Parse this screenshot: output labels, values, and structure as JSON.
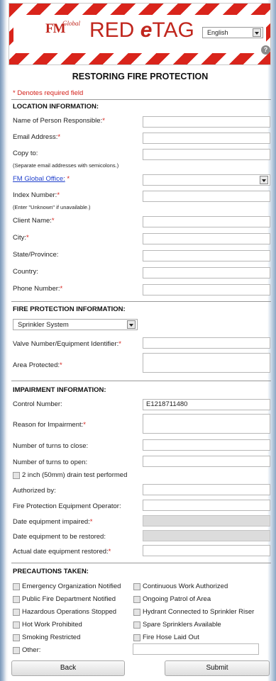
{
  "header": {
    "logo_fm": "FM",
    "logo_global": "Global",
    "app_title_red": "RED ",
    "app_title_e": "e",
    "app_title_tag": "TAG",
    "language": "English",
    "help_symbol": "?"
  },
  "page_title": "RESTORING FIRE PROTECTION",
  "required_note": "* Denotes required field",
  "location": {
    "heading": "LOCATION INFORMATION:",
    "person_label": "Name of Person Responsible:",
    "email_label": "Email Address:",
    "copy_label": "Copy to:",
    "copy_hint": "(Separate email addresses with semicolons.)",
    "office_label": "FM Global Office:",
    "index_label": "Index Number:",
    "index_hint": "(Enter \"Unknown\" if unavailable.)",
    "client_label": "Client Name:",
    "city_label": "City:",
    "state_label": "State/Province:",
    "country_label": "Country:",
    "phone_label": "Phone Number:"
  },
  "fire_protection": {
    "heading": "FIRE PROTECTION INFORMATION:",
    "system_type": "Sprinkler System",
    "valve_label": "Valve Number/Equipment Identifier:",
    "area_label": "Area Protected:"
  },
  "impairment": {
    "heading": "IMPAIRMENT INFORMATION:",
    "control_label": "Control Number:",
    "control_value": "E1218711480",
    "reason_label": "Reason for Impairment:",
    "turns_close_label": "Number of turns to close:",
    "turns_open_label": "Number of turns to open:",
    "drain_test_label": "2 inch (50mm) drain test performed",
    "authorized_label": "Authorized by:",
    "operator_label": "Fire Protection Equipment Operator:",
    "date_impaired_label": "Date equipment impaired:",
    "date_restore_label": "Date equipment to be restored:",
    "actual_date_label": "Actual date equipment restored:"
  },
  "precautions": {
    "heading": "PRECAUTIONS TAKEN:",
    "left": [
      "Emergency Organization Notified",
      "Public Fire Department Notified",
      "Hazardous Operations Stopped",
      "Hot Work Prohibited",
      "Smoking Restricted",
      "Other:"
    ],
    "right": [
      "Continuous Work Authorized",
      "Ongoing Patrol of Area",
      "Hydrant Connected to Sprinkler Riser",
      "Spare Sprinklers Available",
      "Fire Hose Laid Out"
    ]
  },
  "buttons": {
    "back": "Back",
    "submit": "Submit"
  },
  "required_mark": "*",
  "colors": {
    "brand_red": "#d9241b",
    "required_red": "#d4201a",
    "link_blue": "#1f3fcc"
  }
}
